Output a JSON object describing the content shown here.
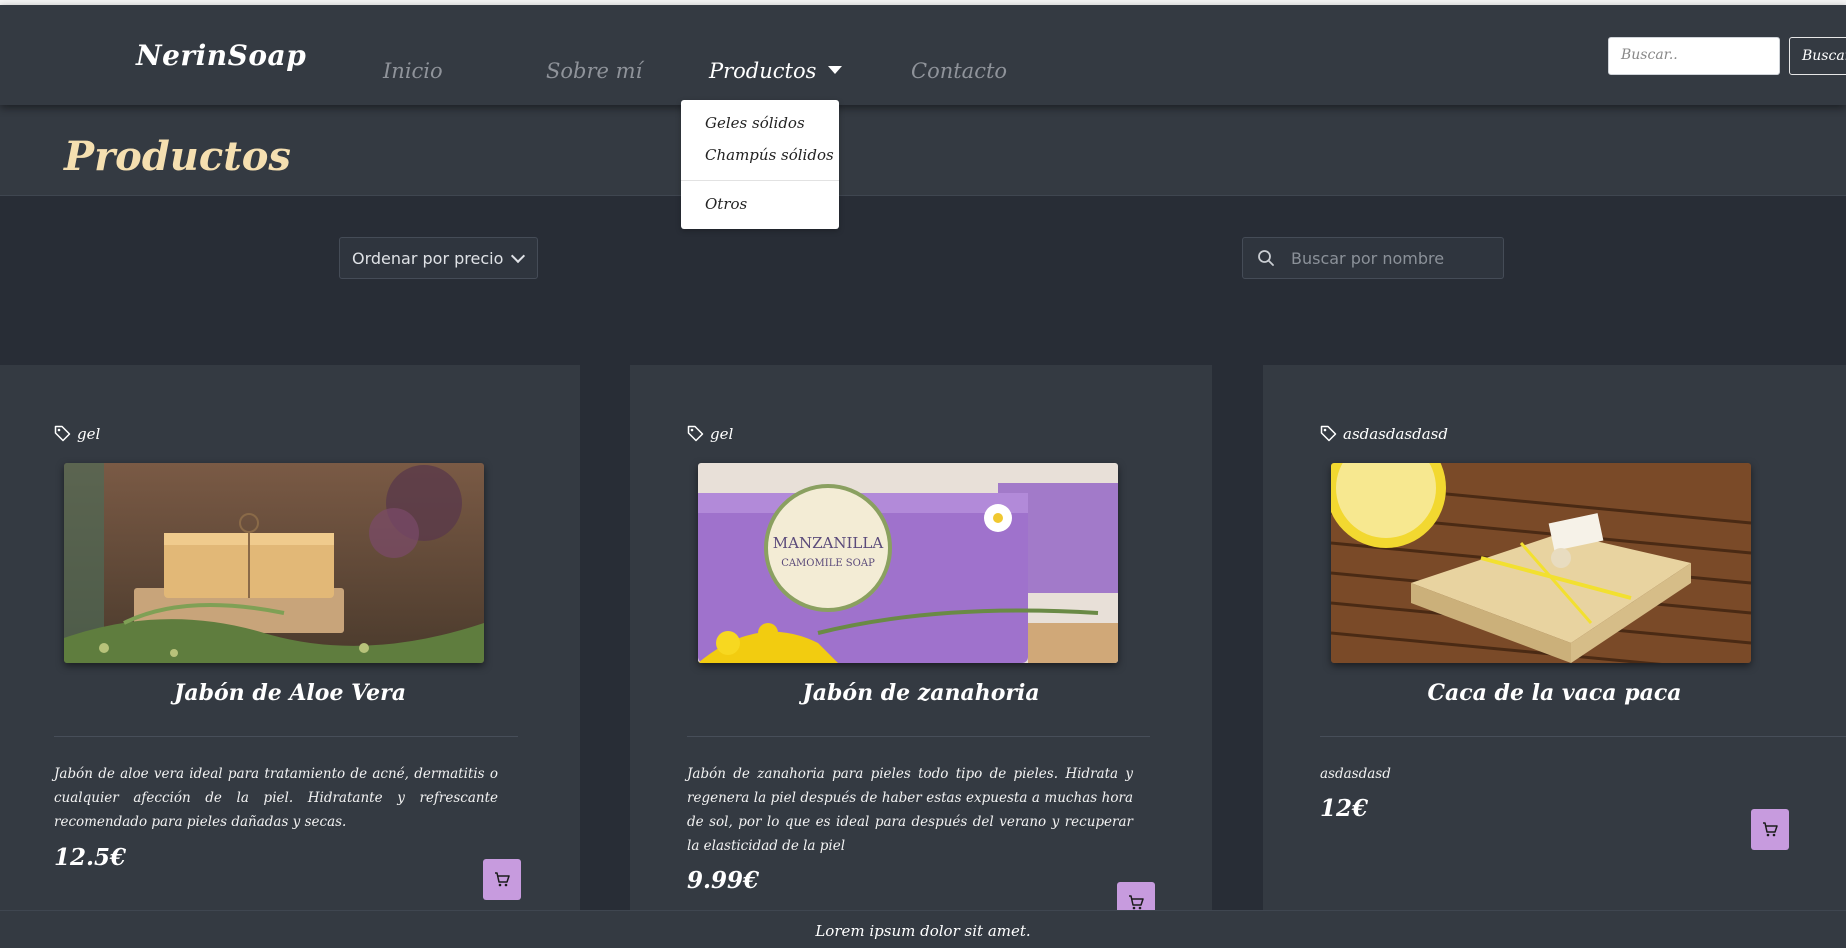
{
  "navbar": {
    "brand": "NerinSoap",
    "links": [
      {
        "label": "Inicio"
      },
      {
        "label": "Sobre mí"
      },
      {
        "label": "Productos"
      },
      {
        "label": "Contacto"
      }
    ],
    "search_placeholder": "Buscar..",
    "search_button": "Buscar"
  },
  "dropdown": {
    "items": [
      {
        "label": "Geles sólidos"
      },
      {
        "label": "Champús sólidos"
      },
      {
        "label": "Otros"
      }
    ]
  },
  "page": {
    "title": "Productos"
  },
  "filters": {
    "sort_label": "Ordenar por precio",
    "search_placeholder": "Buscar por nombre"
  },
  "products": [
    {
      "tag": "gel",
      "title": "Jabón de Aloe Vera",
      "description": "Jabón de aloe vera ideal para tratamiento de acné, dermatitis o cualquier afección de la piel. Hidratante y refrescante recomendado para pieles dañadas y secas.",
      "price": "12.5€",
      "image": "soap-with-herbs-photo"
    },
    {
      "tag": "gel",
      "title": "Jabón de zanahoria",
      "description": "Jabón de zanahoria para pieles todo tipo de pieles. Hidrata y regenera la piel después de haber estas expuesta a muchas hora de sol, por lo que es ideal para después del verano y recuperar la elasticidad de la piel",
      "price": "9.99€",
      "image": "camomile-soap-photo"
    },
    {
      "tag": "asdasdasdasd",
      "title": "Caca de la vaca paca",
      "description": "asdasdasd",
      "price": "12€",
      "image": "lemon-soap-photo"
    }
  ],
  "footer": {
    "text": "Lorem ipsum dolor sit amet."
  },
  "colors": {
    "background": "#282d36",
    "panel": "#343a42",
    "accent_cart": "#c79bde",
    "title_cream": "#f5dfb0"
  }
}
